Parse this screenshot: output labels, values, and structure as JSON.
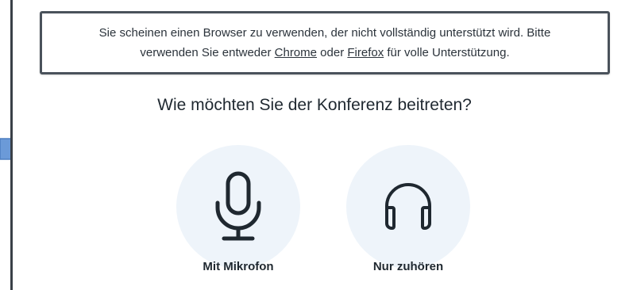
{
  "warning": {
    "line1": "Sie scheinen einen Browser zu verwenden, der nicht vollständig unterstützt wird. Bitte",
    "line2_prefix": "verwenden Sie entweder ",
    "chrome_link": "Chrome",
    "middle": " oder ",
    "firefox_link": "Firefox",
    "line2_suffix": " für volle Unterstützung."
  },
  "join_dialog": {
    "title": "Wie möchten Sie der Konferenz beitreten?",
    "options": [
      {
        "label": "Mit Mikrofon",
        "icon": "microphone-icon"
      },
      {
        "label": "Nur zuhören",
        "icon": "headphones-icon"
      }
    ]
  },
  "colors": {
    "accent": "#6b9ad8",
    "circle_bg": "#eef4fa",
    "icon_stroke": "#1f2830",
    "frame": "#3a4048"
  }
}
